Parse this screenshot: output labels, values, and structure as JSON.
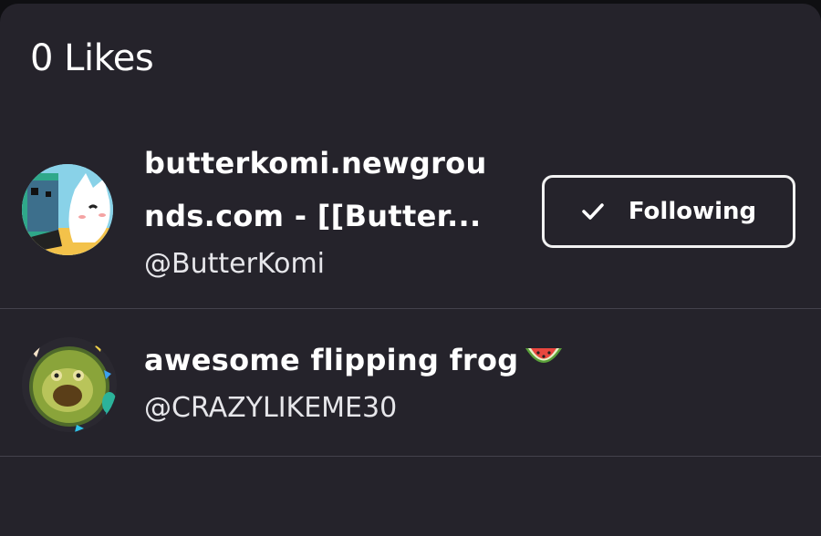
{
  "header": {
    "title": "0 Likes"
  },
  "users": [
    {
      "name": "butterkomi.newgrounds.com - [[Butter...",
      "name_line1": "butterkomi.newgrou",
      "name_line2": "nds.com - [[Butter...",
      "handle": "@ButterKomi",
      "avatar": "cartoon-avatar-icon",
      "follow_label": "Following",
      "follow_icon": "check-icon"
    },
    {
      "name": "awesome flipping frog",
      "name_emoji": "watermelon-icon",
      "handle": "@CRAZYLIKEME30",
      "avatar": "frog-party-avatar-icon"
    }
  ],
  "colors": {
    "background": "#25232b",
    "text": "#ffffff",
    "divider": "#44424c",
    "button_border": "#f2f2f2"
  }
}
